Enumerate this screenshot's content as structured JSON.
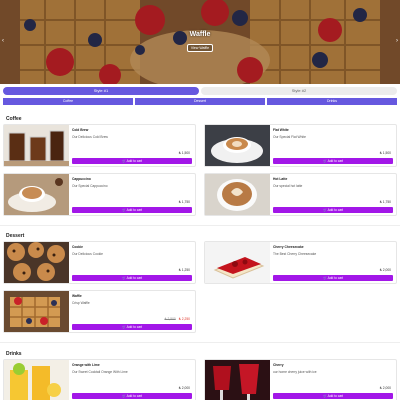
{
  "hero": {
    "title": "Waffle",
    "button_label": "View Waffle",
    "prev_arrow": "‹",
    "next_arrow": "›"
  },
  "style_tabs": [
    {
      "label": "Style #1",
      "active": true
    },
    {
      "label": "Style #2",
      "active": false
    }
  ],
  "category_tabs": [
    "Coffee",
    "Dessert",
    "Drinks"
  ],
  "sections": {
    "coffee": {
      "title": "Coffee",
      "items": [
        {
          "name": "Cold Brew",
          "desc": "Our Delicious Cold Brew",
          "price": "₺ 1,500",
          "button": "🛒 Add to cart"
        },
        {
          "name": "Flat White",
          "desc": "Our Special Flat White",
          "price": "₺ 1,500",
          "button": "🛒 Add to cart"
        },
        {
          "name": "Cappuccino",
          "desc": "Our Special Cappuccino",
          "price": "₺ 1,750",
          "button": "🛒 Add to cart"
        },
        {
          "name": "Hot Latte",
          "desc": "Our special hot latte",
          "price": "₺ 1,750",
          "button": "🛒 Add to cart"
        }
      ]
    },
    "dessert": {
      "title": "Dessert",
      "items": [
        {
          "name": "Cookie",
          "desc": "Our Delicious Cookie",
          "price": "₺ 1,250",
          "button": "🛒 Add to cart"
        },
        {
          "name": "Cherry Cheesecake",
          "desc": "The Best Cherry Cheesecake",
          "price": "₺ 2,000",
          "button": "🛒 Add to cart"
        },
        {
          "name": "Waffle",
          "desc": "Crisp Waffle",
          "old_price": "₺ 2,500",
          "price": "₺ 2,250",
          "button": "🛒 Add to cart"
        }
      ]
    },
    "drinks": {
      "title": "Drinks",
      "items": [
        {
          "name": "Orange with Lime",
          "desc": "Our Sweet Cocktail Orange With Lime",
          "price": "₺ 2,000",
          "button": "🛒 Add to cart"
        },
        {
          "name": "Cherry",
          "desc": "our home cherry juice with ice",
          "price": "₺ 2,000",
          "button": "🛒 Add to cart"
        }
      ]
    }
  },
  "colors": {
    "primary": "#6658df",
    "cart_button": "#a217e8",
    "sale_price": "#e0342a"
  }
}
